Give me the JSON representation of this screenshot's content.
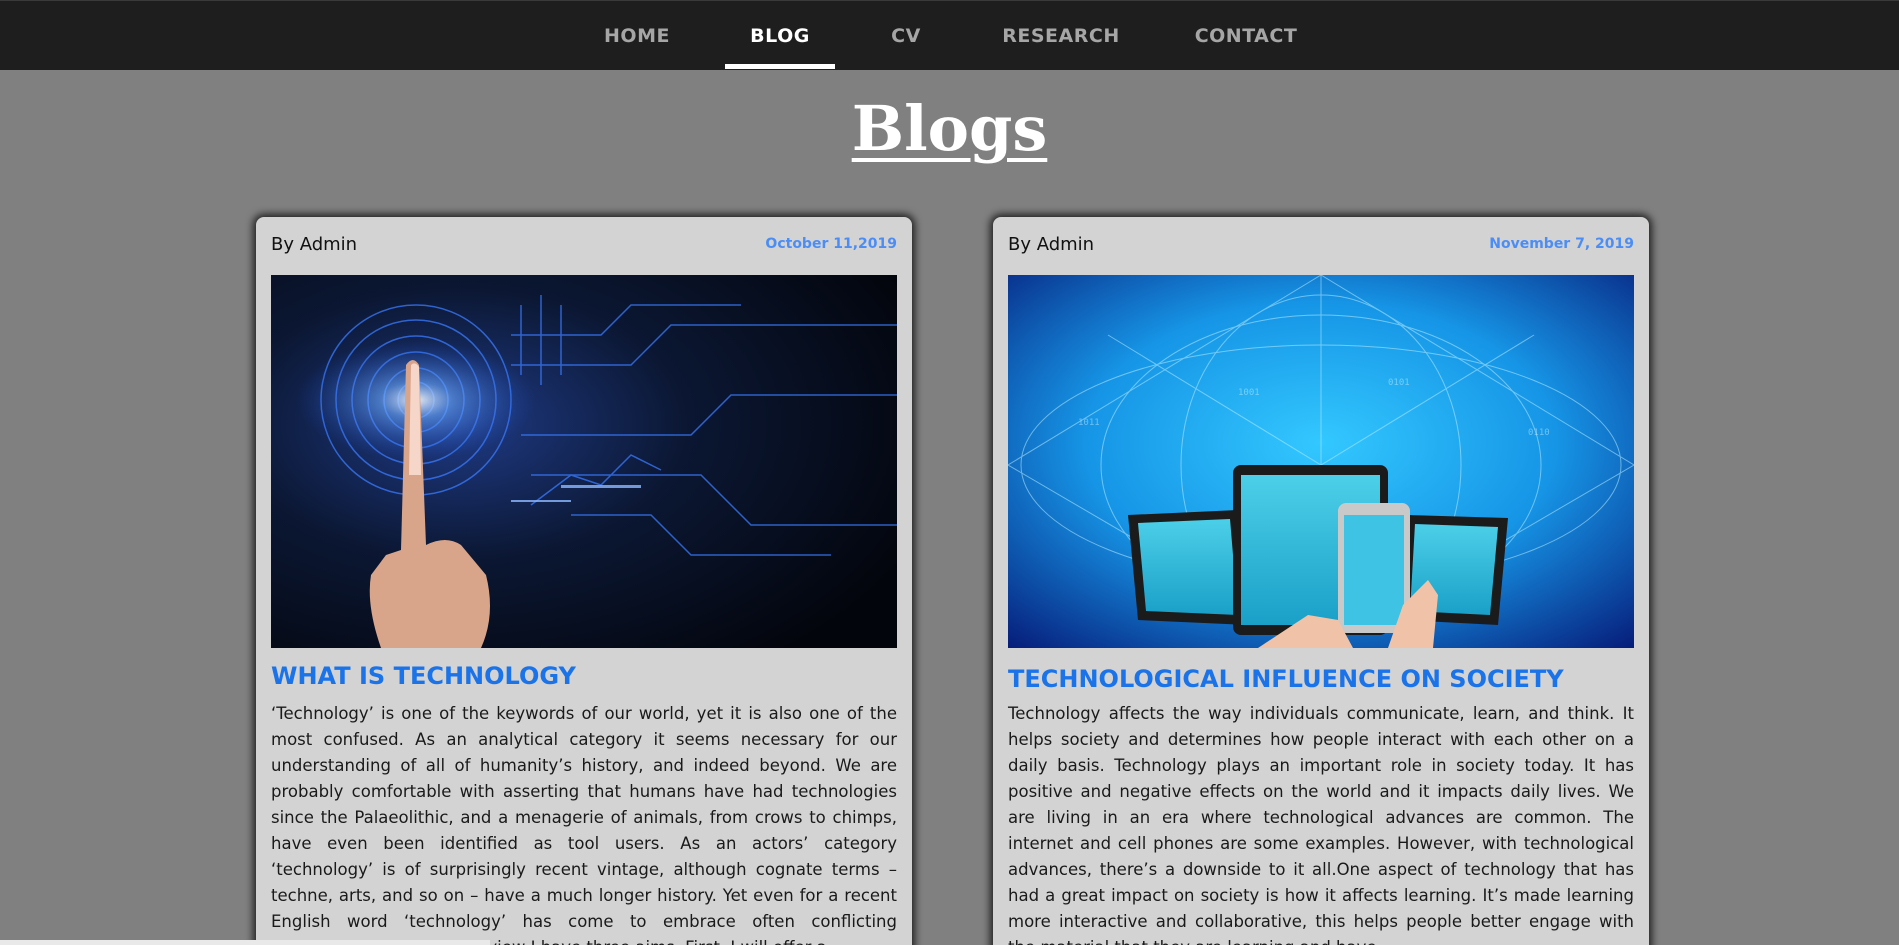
{
  "nav": {
    "items": [
      {
        "label": "HOME"
      },
      {
        "label": "BLOG"
      },
      {
        "label": "CV"
      },
      {
        "label": "RESEARCH"
      },
      {
        "label": "CONTACT"
      }
    ],
    "active": "BLOG"
  },
  "page": {
    "title": "Blogs"
  },
  "posts": [
    {
      "author": "By Admin",
      "date": "October 11,2019",
      "image_icon": "fingerprint-circuit-image",
      "title": "WHAT IS TECHNOLOGY",
      "text": "‘Technology’ is one of the keywords of our world, yet it is also one of the most confused. As an analytical category it seems necessary for our understanding of all of humanity’s history, and indeed beyond. We are probably comfortable with asserting that humans have had technologies since the Palaeolithic, and a menagerie of animals, from crows to chimps, have even been identified as tool users. As an actors’ category ‘technology’ is of surprisingly recent vintage, although cognate terms – techne, arts, and so on – have a much longer history. Yet even for a recent English word ‘technology’ has come to embrace often conflicting meanings. In this essay review I have three aims. First, I will offer a"
    },
    {
      "author": "By Admin",
      "date": "November 7, 2019",
      "image_icon": "devices-network-image",
      "title": "TECHNOLOGICAL INFLUENCE ON SOCIETY",
      "text": "Technology affects the way individuals communicate, learn, and think. It helps society and determines how people interact with each other on a daily basis. Technology plays an important role in society today. It has positive and negative effects on the world and it impacts daily lives. We are living in an era where technological advances are common. The internet and cell phones are some examples. However, with technological advances, there’s a downside to it all.One aspect of technology that has had a great impact on society is how it affects learning. It’s made learning more interactive and collaborative, this helps people better engage with the material that they are learning and have"
    }
  ],
  "colors": {
    "nav_bg": "#1e1e1e",
    "page_bg": "#808080",
    "card_bg": "#d3d3d3",
    "title_blue": "#1a73e8",
    "date_blue": "#4c8df5"
  }
}
